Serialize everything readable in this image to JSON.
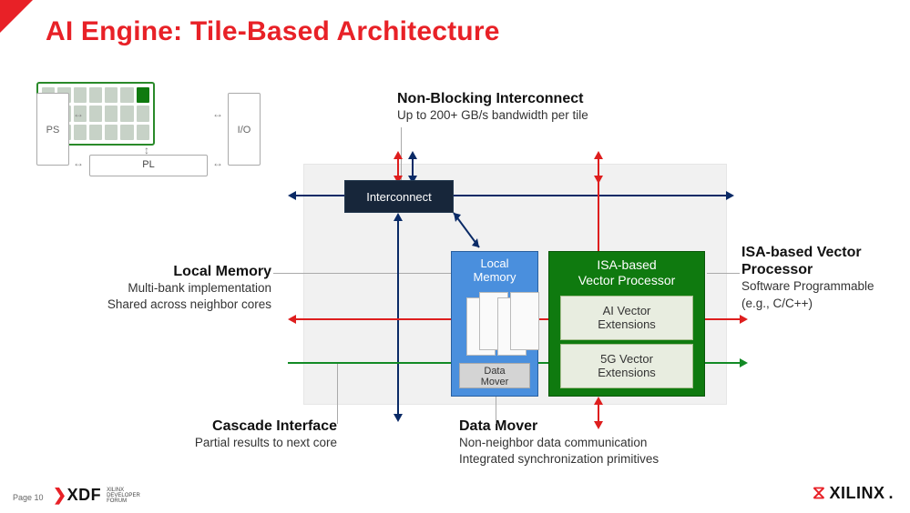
{
  "title": "AI Engine:   Tile-Based Architecture",
  "overview": {
    "ps": "PS",
    "io": "I/O",
    "pl": "PL"
  },
  "callouts": {
    "nonblocking": {
      "h": "Non-Blocking Interconnect",
      "p": "Up to 200+ GB/s bandwidth per tile"
    },
    "localmem": {
      "h": "Local Memory",
      "p1": "Multi-bank implementation",
      "p2": "Shared across neighbor cores"
    },
    "cascade": {
      "h": "Cascade Interface",
      "p": "Partial results to next core"
    },
    "datamover": {
      "h": "Data Mover",
      "p1": "Non-neighbor data communication",
      "p2": "Integrated synchronization primitives"
    },
    "vecproc": {
      "h": "ISA-based Vector Processor",
      "p1": "Software Programmable",
      "p2": "(e.g., C/C++)"
    }
  },
  "blocks": {
    "interconnect": "Interconnect",
    "localmem_title_l1": "Local",
    "localmem_title_l2": "Memory",
    "datamover_l1": "Data",
    "datamover_l2": "Mover",
    "vecproc_title_l1": "ISA-based",
    "vecproc_title_l2": "Vector Processor",
    "ext_ai_l1": "AI Vector",
    "ext_ai_l2": "Extensions",
    "ext_5g_l1": "5G Vector",
    "ext_5g_l2": "Extensions"
  },
  "colors": {
    "blue": "#0a2a66",
    "red": "#de1e1e",
    "green": "#128a25"
  },
  "footer": {
    "page": "Page 10",
    "xdf": "XDF",
    "xdf_sub_l1": "XILINX",
    "xdf_sub_l2": "DEVELOPER",
    "xdf_sub_l3": "FORUM",
    "xilinx": "XILINX",
    "dot": "."
  }
}
